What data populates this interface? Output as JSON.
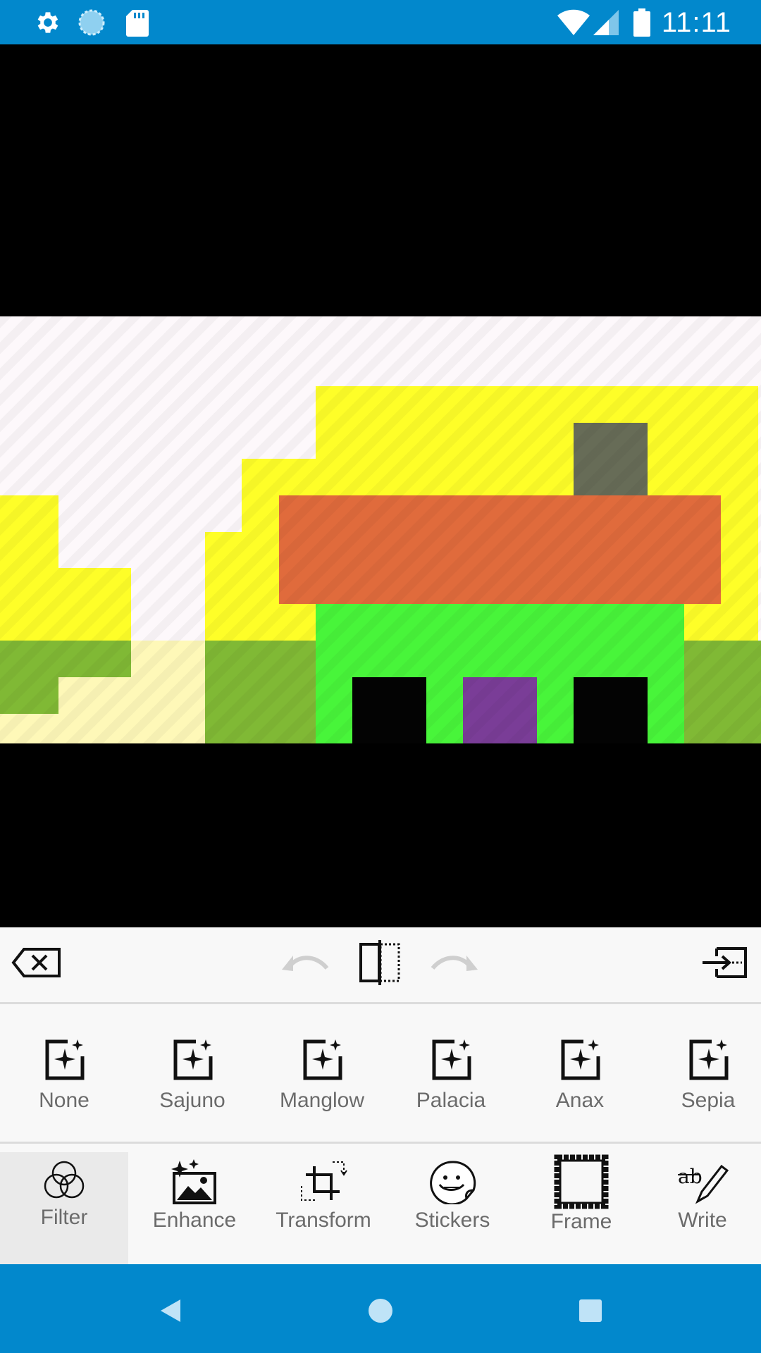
{
  "status_bar": {
    "time": "11:11",
    "icons": [
      "settings-icon",
      "sync-icon",
      "sd-card-icon",
      "wifi-icon",
      "cellular-signal-icon",
      "battery-icon"
    ]
  },
  "editor_toolbar": {
    "icons": [
      "delete-icon",
      "undo-icon",
      "compare-icon",
      "redo-icon",
      "export-icon"
    ]
  },
  "filters": [
    {
      "label": "None"
    },
    {
      "label": "Sajuno"
    },
    {
      "label": "Manglow"
    },
    {
      "label": "Palacia"
    },
    {
      "label": "Anax"
    },
    {
      "label": "Sepia"
    }
  ],
  "tabs": [
    {
      "label": "Filter",
      "icon": "filter-icon",
      "active": true
    },
    {
      "label": "Enhance",
      "icon": "enhance-icon"
    },
    {
      "label": "Transform",
      "icon": "transform-icon"
    },
    {
      "label": "Stickers",
      "icon": "stickers-icon"
    },
    {
      "label": "Frame",
      "icon": "frame-icon"
    },
    {
      "label": "Write",
      "icon": "write-icon"
    }
  ],
  "colors": {
    "accent": "#0288cc",
    "panel": "#f8f8f8",
    "label": "#6b6b6b"
  },
  "nav_bar": {
    "icons": [
      "back-icon",
      "home-icon",
      "recents-icon"
    ]
  }
}
